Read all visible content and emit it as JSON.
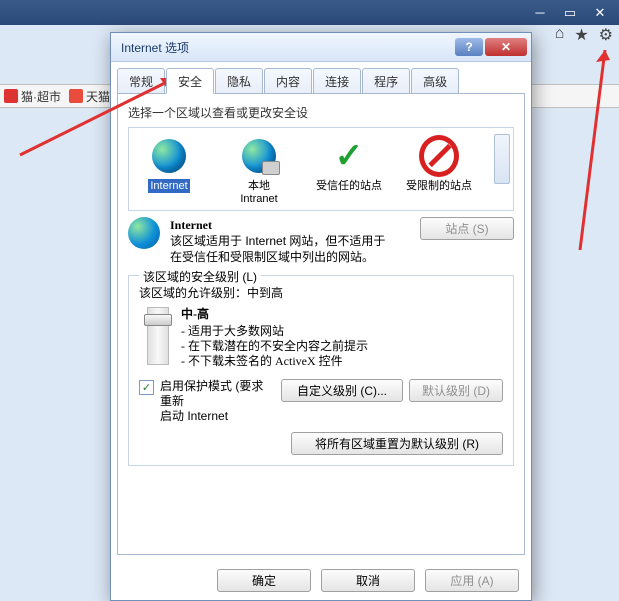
{
  "browser": {
    "bookmarks": [
      {
        "label": "猫·超市"
      },
      {
        "label": "天猫"
      }
    ]
  },
  "dialog": {
    "title": "Internet 选项",
    "tabs": [
      "常规",
      "安全",
      "隐私",
      "内容",
      "连接",
      "程序",
      "高级"
    ],
    "active_tab": 1,
    "zone_prompt": "选择一个区域以查看或更改安全设",
    "zones": {
      "internet": {
        "label": "Internet"
      },
      "local": {
        "label": "本地",
        "sub": "Intranet"
      },
      "trusted": {
        "label": "受信任的站点"
      },
      "restricted": {
        "label": "受限制的站点"
      }
    },
    "zone_desc": {
      "heading": "Internet",
      "line1": "该区域适用于 Internet 网站，但不适用于",
      "line2": "在受信任和受限制区域中列出的网站。"
    },
    "sites_btn": "站点 (S)",
    "level_group": "该区域的安全级别 (L)",
    "allowed_line": "该区域的允许级别：中到高",
    "level_name": "中-高",
    "bullets": [
      "- 适用于大多数网站",
      "- 在下载潜在的不安全内容之前提示",
      "- 不下载未签名的 ActiveX 控件"
    ],
    "protect_label1": "启用保护模式 (要求重新",
    "protect_label2": "启动 Internet",
    "custom_btn": "自定义级别 (C)...",
    "default_btn": "默认级别 (D)",
    "reset_btn": "将所有区域重置为默认级别 (R)",
    "ok": "确定",
    "cancel": "取消",
    "apply": "应用 (A)"
  }
}
